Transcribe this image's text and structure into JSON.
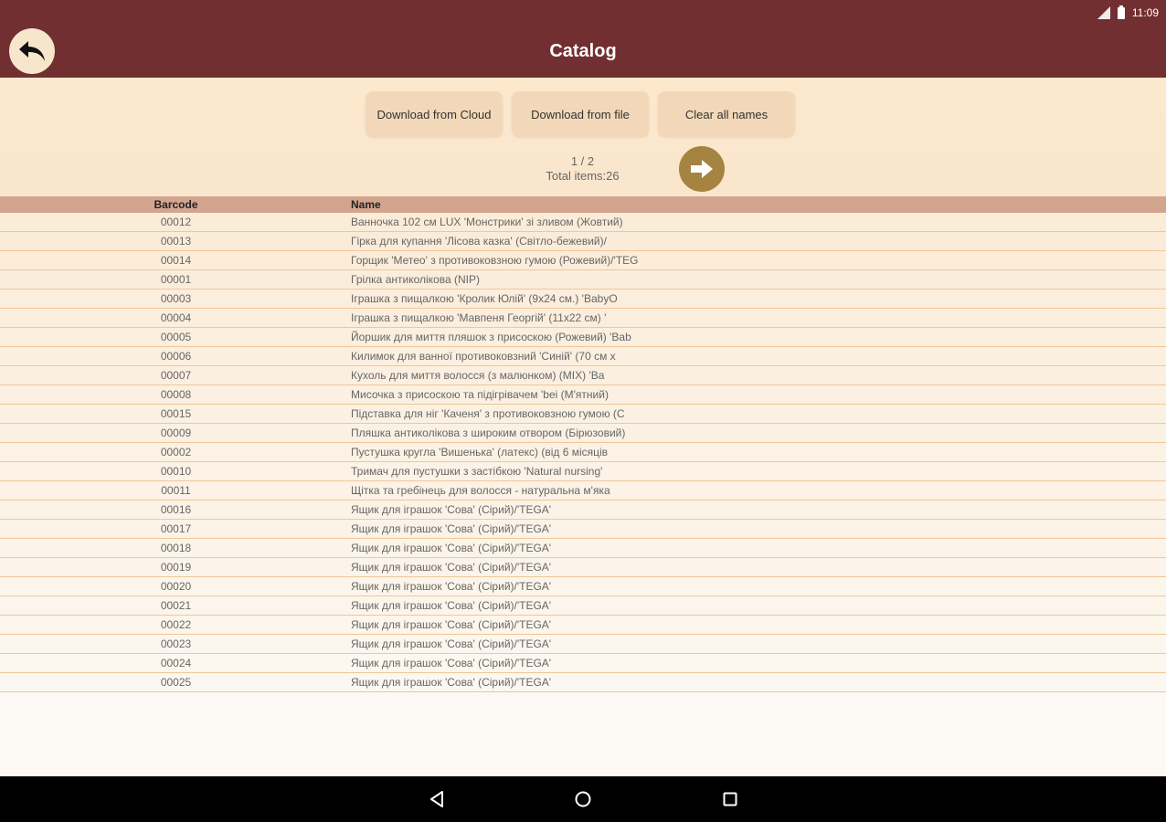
{
  "status": {
    "time": "11:09",
    "signal_icon": "signal-icon",
    "battery_icon": "battery-icon"
  },
  "appbar": {
    "title": "Catalog",
    "back_icon": "back-arrow-icon"
  },
  "controls": {
    "download_cloud_label": "Download from Cloud",
    "download_file_label": "Download from file",
    "clear_names_label": "Clear all names",
    "pager": {
      "page_text": "1 / 2",
      "total_text": "Total items:26"
    },
    "next_icon": "arrow-right-icon"
  },
  "table": {
    "headers": {
      "barcode": "Barcode",
      "name": "Name"
    },
    "rows": [
      {
        "barcode": "00012",
        "name": "Ванночка 102 см LUX 'Монстрики' зі зливом (Жовтий)"
      },
      {
        "barcode": "00013",
        "name": "Гірка для купання 'Лісова казка' (Світло-бежевий)/"
      },
      {
        "barcode": "00014",
        "name": "Горщик 'Метео' з противоковзною гумою (Рожевий)/'TEG"
      },
      {
        "barcode": "00001",
        "name": "Грілка антиколікова (NIP)"
      },
      {
        "barcode": "00003",
        "name": "Іграшка з пищалкою 'Кролик Юлій' (9x24 см.) 'BabyO"
      },
      {
        "barcode": "00004",
        "name": "Іграшка з пищалкою 'Мавпеня Георгій' (11x22 см) '"
      },
      {
        "barcode": "00005",
        "name": "Йоршик для миття пляшок з присоскою (Рожевий) 'Bab"
      },
      {
        "barcode": "00006",
        "name": "Килимок для ванної противоковзний 'Синій' (70 см х"
      },
      {
        "barcode": "00007",
        "name": "Кухоль для миття волосся (з малюнком) (MIX) 'Ba"
      },
      {
        "barcode": "00008",
        "name": "Мисочка з присоскою та підігрівачем 'bei (М'ятний)"
      },
      {
        "barcode": "00015",
        "name": "Підставка для ніг 'Каченя' з противоковзною гумою (С"
      },
      {
        "barcode": "00009",
        "name": "Пляшка антиколікова з широким отвором (Бірюзовий)"
      },
      {
        "barcode": "00002",
        "name": "Пустушка кругла 'Вишенька' (латекс) (від 6 місяців"
      },
      {
        "barcode": "00010",
        "name": "Тримач для пустушки з застібкою 'Natural nursing'"
      },
      {
        "barcode": "00011",
        "name": "Щітка та гребінець для волосся - натуральна м'яка"
      },
      {
        "barcode": "00016",
        "name": "Ящик для іграшок 'Сова' (Сірий)/'TEGA'"
      },
      {
        "barcode": "00017",
        "name": "Ящик для іграшок 'Сова' (Сірий)/'TEGA'"
      },
      {
        "barcode": "00018",
        "name": "Ящик для іграшок 'Сова' (Сірий)/'TEGA'"
      },
      {
        "barcode": "00019",
        "name": "Ящик для іграшок 'Сова' (Сірий)/'TEGA'"
      },
      {
        "barcode": "00020",
        "name": "Ящик для іграшок 'Сова' (Сірий)/'TEGA'"
      },
      {
        "barcode": "00021",
        "name": "Ящик для іграшок 'Сова' (Сірий)/'TEGA'"
      },
      {
        "barcode": "00022",
        "name": "Ящик для іграшок 'Сова' (Сірий)/'TEGA'"
      },
      {
        "barcode": "00023",
        "name": "Ящик для іграшок 'Сова' (Сірий)/'TEGA'"
      },
      {
        "barcode": "00024",
        "name": "Ящик для іграшок 'Сова' (Сірий)/'TEGA'"
      },
      {
        "barcode": "00025",
        "name": "Ящик для іграшок 'Сова' (Сірий)/'TEGA'"
      }
    ]
  },
  "navbar": {
    "back_icon": "nav-back-icon",
    "home_icon": "nav-home-icon",
    "recents_icon": "nav-recents-icon"
  },
  "colors": {
    "appbar": "#722f32",
    "header_row": "#d3a58e",
    "button": "#f2d8b8",
    "next_button": "#a48440"
  }
}
